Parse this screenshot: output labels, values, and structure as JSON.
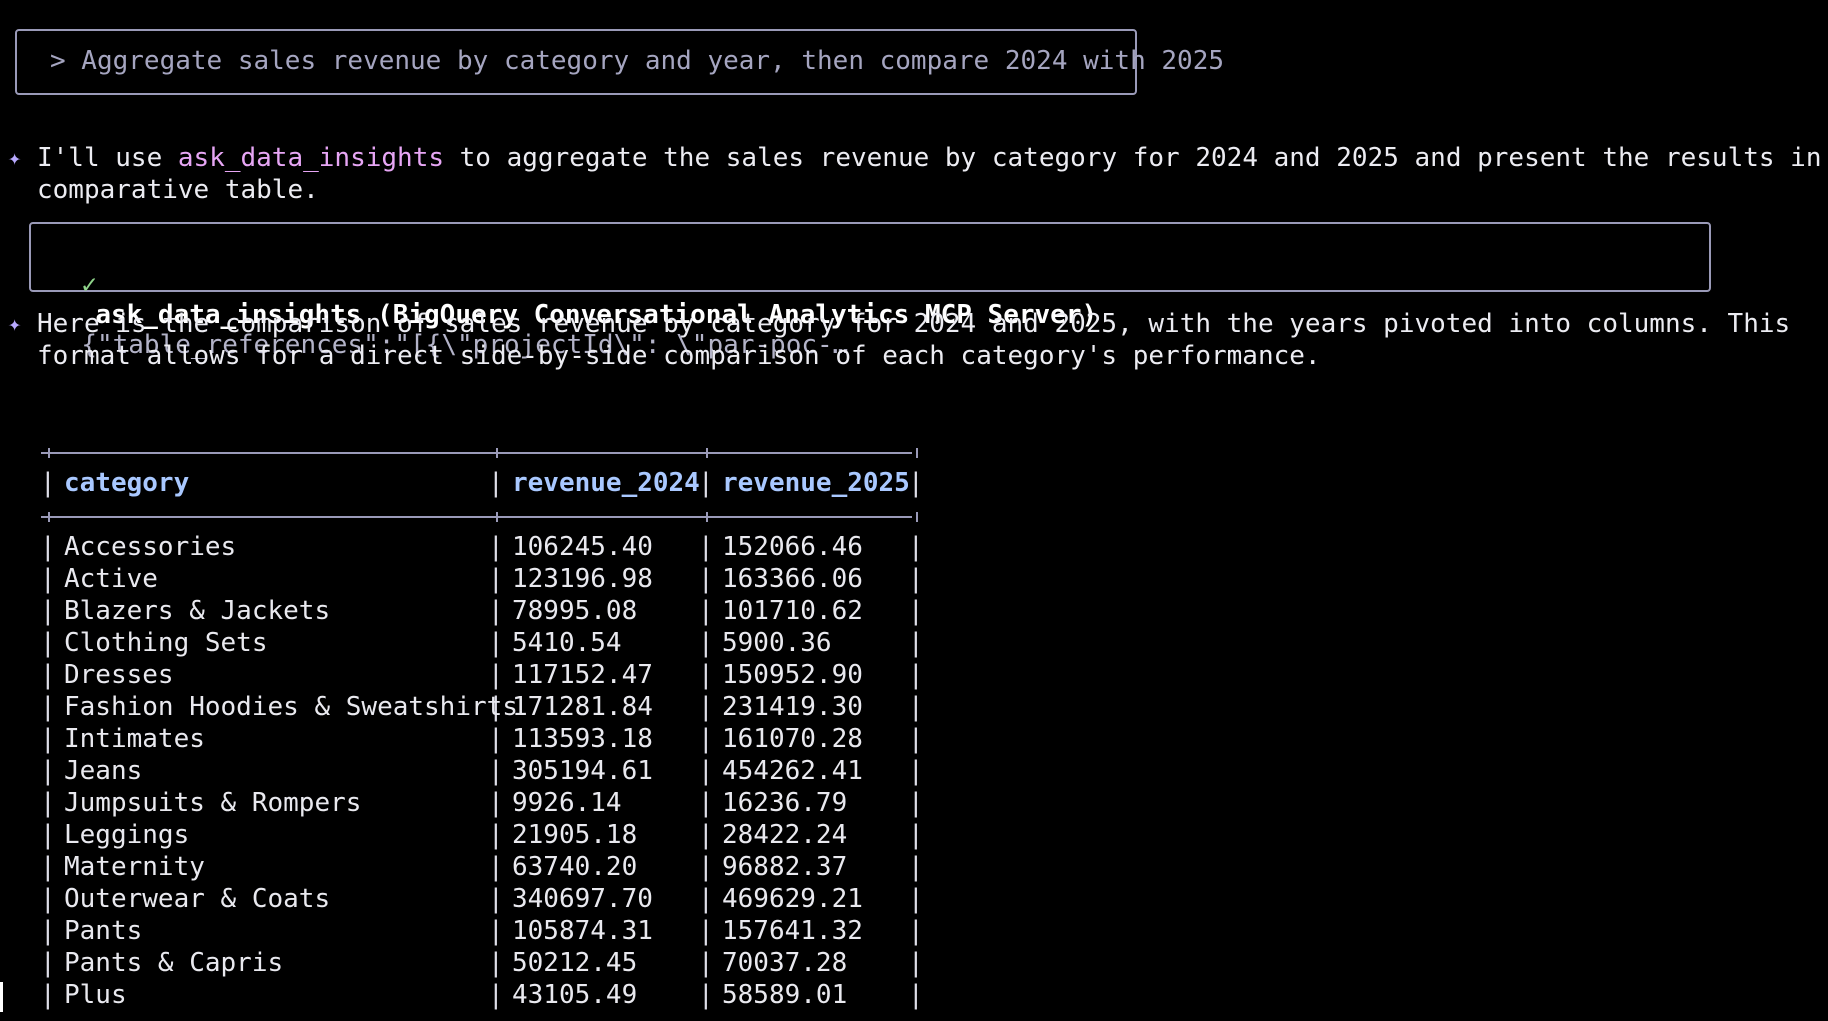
{
  "prompt": {
    "text": "> Aggregate sales revenue by category and year, then compare 2024 with 2025"
  },
  "messages": [
    {
      "star": "✦",
      "pre": "I'll use ",
      "highlight": "ask_data_insights",
      "post": " to aggregate the sales revenue by category for 2024 and 2025 and present the results in a",
      "line2": "comparative table."
    },
    {
      "star": "✦",
      "line1": "Here is the comparison of sales revenue by category for 2024 and 2025, with the years pivoted into columns. This",
      "line2": "format allows for a direct side-by-side comparison of each category's performance."
    }
  ],
  "tool_call": {
    "check": "✓",
    "name": "ask_data_insights (BigQuery Conversational Analytics MCP Server)",
    "args": "{\"table_references\":\"[{\\\"projectId\\\": \\\"par-poc-…"
  },
  "table": {
    "headers": [
      "category",
      "revenue_2024",
      "revenue_2025"
    ],
    "rows": [
      [
        "Accessories",
        "106245.40",
        "152066.46"
      ],
      [
        "Active",
        "123196.98",
        "163366.06"
      ],
      [
        "Blazers & Jackets",
        "78995.08",
        "101710.62"
      ],
      [
        "Clothing Sets",
        "5410.54",
        "5900.36"
      ],
      [
        "Dresses",
        "117152.47",
        "150952.90"
      ],
      [
        "Fashion Hoodies & Sweatshirts",
        "171281.84",
        "231419.30"
      ],
      [
        "Intimates",
        "113593.18",
        "161070.28"
      ],
      [
        "Jeans",
        "305194.61",
        "454262.41"
      ],
      [
        "Jumpsuits & Rompers",
        "9926.14",
        "16236.79"
      ],
      [
        "Leggings",
        "21905.18",
        "28422.24"
      ],
      [
        "Maternity",
        "63740.20",
        "96882.37"
      ],
      [
        "Outerwear & Coats",
        "340697.70",
        "469629.21"
      ],
      [
        "Pants",
        "105874.31",
        "157641.32"
      ],
      [
        "Pants & Capris",
        "50212.45",
        "70037.28"
      ],
      [
        "Plus",
        "43105.49",
        "58589.01"
      ]
    ]
  },
  "colors": {
    "background": "#000000",
    "border": "#9a9ab8",
    "highlight": "#e7a6f5",
    "header": "#a9c8ff",
    "check": "#8fd48a"
  }
}
